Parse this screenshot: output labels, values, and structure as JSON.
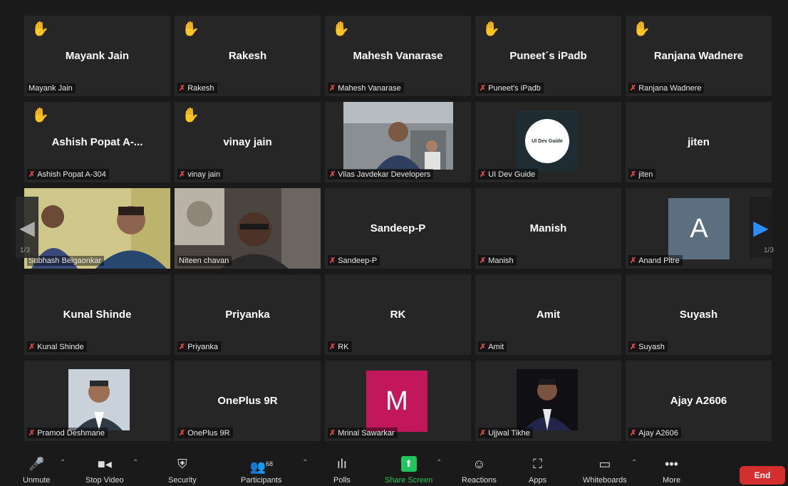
{
  "tiles": [
    {
      "name": "Mayank Jain",
      "label": "Mayank Jain",
      "hand": true,
      "muted": false
    },
    {
      "name": "Rakesh",
      "label": "Rakesh",
      "hand": true,
      "muted": true
    },
    {
      "name": "Mahesh Vanarase",
      "label": "Mahesh Vanarase",
      "hand": true,
      "muted": true
    },
    {
      "name": "Puneet´s iPadb",
      "label": "Puneet's iPadb",
      "hand": true,
      "muted": true
    },
    {
      "name": "Ranjana Wadnere",
      "label": "Ranjana Wadnere",
      "hand": true,
      "muted": true
    },
    {
      "name": "Ashish Popat A-...",
      "label": "Ashish Popat A-304",
      "hand": true,
      "muted": true
    },
    {
      "name": "vinay jain",
      "label": "vinay jain",
      "hand": true,
      "muted": true
    },
    {
      "label": "Vilas Javdekar Developers",
      "muted": true
    },
    {
      "label": "UI Dev Guide",
      "logo_text": "UI Dev Guide",
      "muted": true
    },
    {
      "name": "jiten",
      "label": "jiten",
      "muted": true
    },
    {
      "label": "Subhash Belgaonkar",
      "muted": false
    },
    {
      "label": "Niteen chavan",
      "muted": false
    },
    {
      "name": "Sandeep-P",
      "label": "Sandeep-P",
      "muted": true
    },
    {
      "name": "Manish",
      "label": "Manish",
      "muted": true
    },
    {
      "label": "Anand Pitre",
      "avatar_letter": "A",
      "muted": true
    },
    {
      "name": "Kunal Shinde",
      "label": "Kunal Shinde",
      "muted": true
    },
    {
      "name": "Priyanka",
      "label": "Priyanka",
      "muted": true
    },
    {
      "name": "RK",
      "label": "RK",
      "muted": true
    },
    {
      "name": "Amit",
      "label": "Amit",
      "muted": true
    },
    {
      "name": "Suyash",
      "label": "Suyash",
      "muted": true
    },
    {
      "label": "Pramod Deshmane",
      "muted": true
    },
    {
      "name": "OnePlus 9R",
      "label": "OnePlus 9R",
      "muted": true
    },
    {
      "label": "Mrinal Sawarkar",
      "avatar_letter": "M",
      "muted": true
    },
    {
      "label": "Ujjwal Tikhe",
      "muted": true
    },
    {
      "name": "Ajay A2606",
      "label": "Ajay A2606",
      "muted": true
    }
  ],
  "pager": {
    "left": "1/3",
    "right": "1/3"
  },
  "toolbar": {
    "unmute": "Unmute",
    "stop_video": "Stop Video",
    "security": "Security",
    "participants": "Participants",
    "participants_count": "68",
    "polls": "Polls",
    "share_screen": "Share Screen",
    "reactions": "Reactions",
    "apps": "Apps",
    "whiteboards": "Whiteboards",
    "more": "More",
    "end": "End"
  },
  "colors": {
    "active_speaker": "#d8e27a",
    "share_green": "#22c55e",
    "end_red": "#d32f2f",
    "avatar_a": "#5c6f80",
    "avatar_m": "#c2185b",
    "hand": "#f5b72d"
  }
}
